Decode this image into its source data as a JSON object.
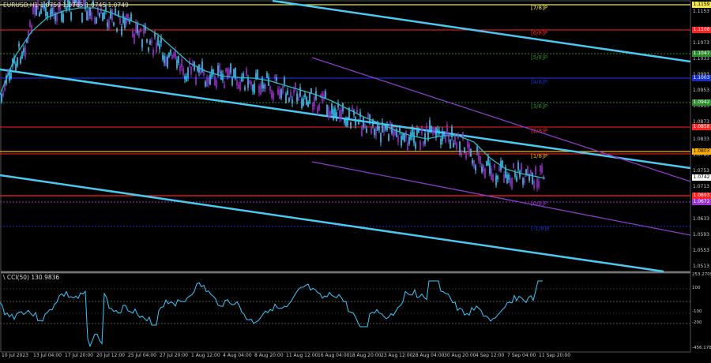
{
  "symbol_header": "EURUSD,H1  1.0759 1.0765 1.0745 1.0749",
  "indicator_header": "\\ CCI(50) 130.9836",
  "price_axis": {
    "ticks": [
      "1.1153",
      "1.1073",
      "1.1033",
      "1.0993",
      "1.0953",
      "1.0913",
      "1.0873",
      "1.0833",
      "1.0793",
      "1.0753",
      "1.0713",
      "1.0673",
      "1.0633",
      "1.0593",
      "1.0553",
      "1.0513"
    ],
    "badges": [
      {
        "text": "1.1159",
        "color": "#f0e64a",
        "text_color": "#000000"
      },
      {
        "text": "1.1108",
        "color": "#ff2020",
        "text_color": "#ffffff"
      },
      {
        "text": "1.1047",
        "color": "#2e8b2e",
        "text_color": "#ffffff"
      },
      {
        "text": "1.1003",
        "color": "#1530c8",
        "text_color": "#ffffff"
      },
      {
        "text": "1.0942",
        "color": "#2e8b2e",
        "text_color": "#ffffff"
      },
      {
        "text": "1.0858",
        "color": "#ff2020",
        "text_color": "#ffffff"
      },
      {
        "text": "1.0803",
        "color": "#ffb000",
        "text_color": "#000000"
      },
      {
        "text": "1.0742",
        "color": "#ffffff",
        "text_color": "#000000"
      },
      {
        "text": "1.0693",
        "color": "#ff2020",
        "text_color": "#ffffff"
      },
      {
        "text": "1.0672",
        "color": "#9b30d0",
        "text_color": "#ffffff"
      }
    ]
  },
  "murray_labels": {
    "top": "[7/8]P",
    "level1": "[6/8]P",
    "level2": "[5/8]P",
    "level3": "[4/8]P",
    "level4": "[3/8]P",
    "level5": "[2/8]P",
    "level6": "[1/8]P",
    "level7": "[0/8]P",
    "level8": "[-1/8]P"
  },
  "cci_axis": {
    "ticks": [
      "253.2709",
      "100",
      "-100",
      "-200",
      "-456.1787"
    ]
  },
  "time_axis": [
    "10 Jul 2023",
    "13 Jul 04:00",
    "17 Jul 20:00",
    "20 Jul 12:00",
    "25 Jul 04:00",
    "27 Jul 20:00",
    "1 Aug 12:00",
    "4 Aug 04:00",
    "8 Aug 20:00",
    "11 Aug 12:00",
    "16 Aug 04:00",
    "18 Aug 20:00",
    "23 Aug 12:00",
    "28 Aug 04:00",
    "30 Aug 20:00",
    "4 Sep 12:00",
    "7 Sep 04:00",
    "11 Sep 20:00"
  ],
  "colors": {
    "bull": "#9b30d0",
    "bear": "#3cc8ff",
    "ma": "#30b8c8",
    "trend": "#4cc8f0",
    "channel": "#8a3cc8"
  }
}
